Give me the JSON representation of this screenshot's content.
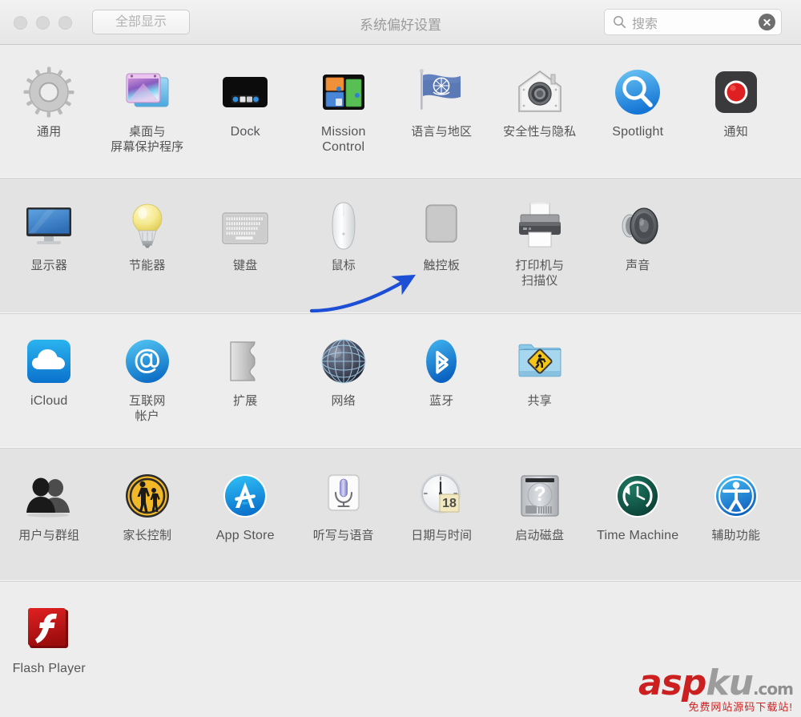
{
  "window": {
    "title": "系统偏好设置",
    "show_all_label": "全部显示",
    "traffic_lights": [
      "close-button",
      "minimize-button",
      "zoom-button"
    ]
  },
  "search": {
    "placeholder": "搜索",
    "icon": "search-icon",
    "clear_icon": "clear-icon"
  },
  "rows": [
    {
      "shade": "light",
      "panes": [
        {
          "label": "通用",
          "icon": "gear-icon",
          "lang": "zh"
        },
        {
          "label": "桌面与\n屏幕保护程序",
          "icon": "desktop-screensaver-icon",
          "lang": "zh"
        },
        {
          "label": "Dock",
          "icon": "dock-icon",
          "lang": "en"
        },
        {
          "label": "Mission\nControl",
          "icon": "mission-control-icon",
          "lang": "en"
        },
        {
          "label": "语言与地区",
          "icon": "language-region-icon",
          "lang": "zh"
        },
        {
          "label": "安全性与隐私",
          "icon": "security-privacy-icon",
          "lang": "zh"
        },
        {
          "label": "Spotlight",
          "icon": "spotlight-icon",
          "lang": "en"
        },
        {
          "label": "通知",
          "icon": "notifications-icon",
          "lang": "zh"
        }
      ]
    },
    {
      "shade": "dark",
      "panes": [
        {
          "label": "显示器",
          "icon": "displays-icon",
          "lang": "zh"
        },
        {
          "label": "节能器",
          "icon": "energy-saver-icon",
          "lang": "zh"
        },
        {
          "label": "键盘",
          "icon": "keyboard-icon",
          "lang": "zh"
        },
        {
          "label": "鼠标",
          "icon": "mouse-icon",
          "lang": "zh"
        },
        {
          "label": "触控板",
          "icon": "trackpad-icon",
          "lang": "zh"
        },
        {
          "label": "打印机与\n扫描仪",
          "icon": "printers-scanners-icon",
          "lang": "zh"
        },
        {
          "label": "声音",
          "icon": "sound-icon",
          "lang": "zh"
        }
      ]
    },
    {
      "shade": "light",
      "panes": [
        {
          "label": "iCloud",
          "icon": "icloud-icon",
          "lang": "en"
        },
        {
          "label": "互联网\n帐户",
          "icon": "internet-accounts-icon",
          "lang": "zh"
        },
        {
          "label": "扩展",
          "icon": "extensions-icon",
          "lang": "zh"
        },
        {
          "label": "网络",
          "icon": "network-icon",
          "lang": "zh"
        },
        {
          "label": "蓝牙",
          "icon": "bluetooth-icon",
          "lang": "zh"
        },
        {
          "label": "共享",
          "icon": "sharing-icon",
          "lang": "zh"
        }
      ]
    },
    {
      "shade": "dark",
      "panes": [
        {
          "label": "用户与群组",
          "icon": "users-groups-icon",
          "lang": "zh"
        },
        {
          "label": "家长控制",
          "icon": "parental-controls-icon",
          "lang": "zh"
        },
        {
          "label": "App Store",
          "icon": "app-store-icon",
          "lang": "en"
        },
        {
          "label": "听写与语音",
          "icon": "dictation-speech-icon",
          "lang": "zh"
        },
        {
          "label": "日期与时间",
          "icon": "date-time-icon",
          "lang": "zh"
        },
        {
          "label": "启动磁盘",
          "icon": "startup-disk-icon",
          "lang": "zh"
        },
        {
          "label": "Time Machine",
          "icon": "time-machine-icon",
          "lang": "en"
        },
        {
          "label": "辅助功能",
          "icon": "accessibility-icon",
          "lang": "zh"
        }
      ]
    },
    {
      "shade": "light",
      "panes": [
        {
          "label": "Flash Player",
          "icon": "flash-player-icon",
          "lang": "en"
        }
      ]
    }
  ],
  "date_time_icon": {
    "day_number": "18"
  },
  "annotation": {
    "type": "curved-arrow",
    "color": "#1c4fd6",
    "points_to": "触控板"
  },
  "watermark": {
    "text_red": "asp",
    "text_gray": "ku",
    "text_com": ".com",
    "subtitle": "免费网站源码下载站!",
    "color_red": "#cc1f1f",
    "color_gray": "#9c9c9c"
  }
}
